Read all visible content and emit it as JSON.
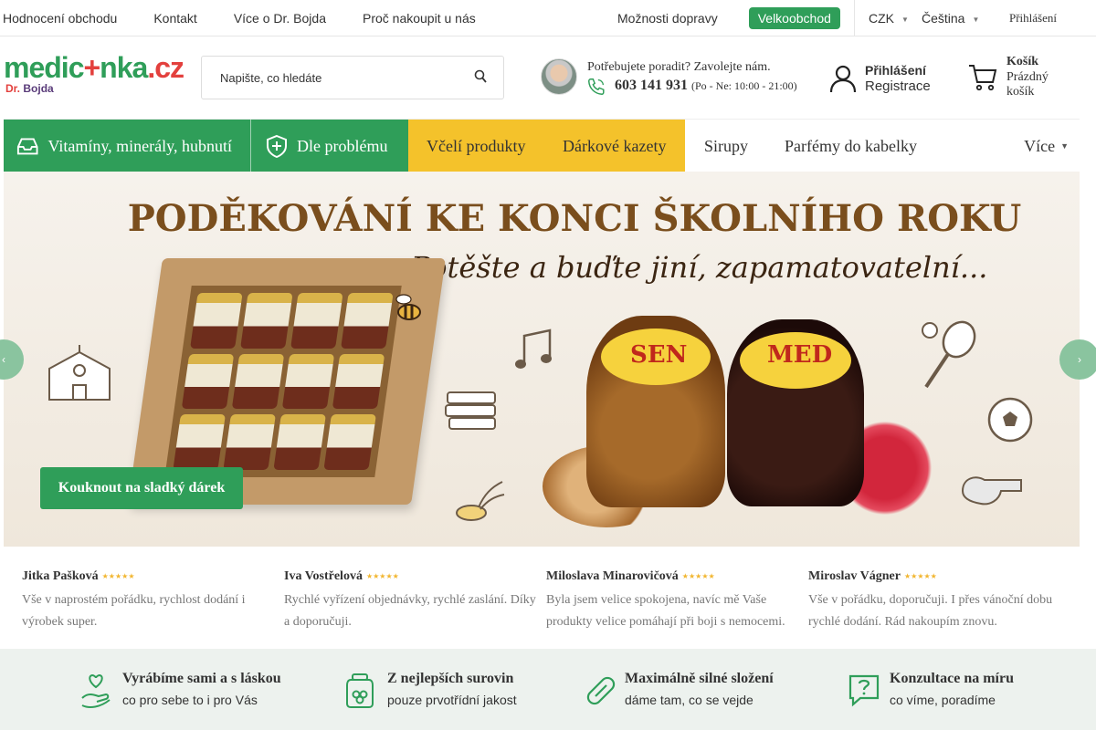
{
  "topbar": {
    "links": [
      "Hodnocení obchodu",
      "Kontakt",
      "Více o Dr. Bojda",
      "Proč nakoupit u nás"
    ],
    "shipping": "Možnosti dopravy",
    "wholesale": "Velkoobchod",
    "currency": "CZK",
    "language": "Čeština",
    "login": "Přihlášení"
  },
  "logo": {
    "part1": "medic",
    "cross": "+",
    "part2": "nka",
    "tld": ".cz",
    "sub_prefix": "Dr.",
    "sub_name": "Bojda"
  },
  "search": {
    "placeholder": "Napište, co hledáte"
  },
  "advice": {
    "question": "Potřebujete poradit? Zavolejte nám.",
    "phone": "603 141 931",
    "hours": "(Po - Ne: 10:00 - 21:00)"
  },
  "account": {
    "login": "Přihlášení",
    "register": "Registrace"
  },
  "cart": {
    "title": "Košík",
    "status": "Prázdný košík"
  },
  "nav": {
    "items": [
      "Vitamíny, minerály, hubnutí",
      "Dle problému",
      "Včelí produkty",
      "Dárkové kazety",
      "Sirupy",
      "Parfémy do kabelky"
    ],
    "more": "Více"
  },
  "banner": {
    "title": "PODĚKOVÁNÍ KE KONCI ŠKOLNÍHO ROKU",
    "subtitle": "Potěšte a buďte jiní, zapamatovatelní...",
    "jar1_label": "SEN",
    "jar2_label": "MED",
    "cta": "Kouknout na sladký dárek"
  },
  "reviews": [
    {
      "name": "Jitka Pašková",
      "stars": "★★★★★",
      "text": "Vše v naprostém pořádku, rychlost dodání i výrobek super."
    },
    {
      "name": "Iva Vostřelová",
      "stars": "★★★★★",
      "text": "Rychlé vyřízení objednávky, rychlé zaslání. Díky a doporučuji."
    },
    {
      "name": "Miloslava Minarovičová",
      "stars": "★★★★★",
      "text": "Byla jsem velice spokojena, navíc mě Vaše produkty velice pomáhají při boji s nemocemi."
    },
    {
      "name": "Miroslav Vágner",
      "stars": "★★★★★",
      "text": "Vše v pořádku, doporučuji. I přes vánoční dobu rychlé dodání. Rád nakoupím znovu."
    }
  ],
  "features": [
    {
      "title": "Vyrábíme sami a s láskou",
      "sub": "co pro sebe to i pro Vás",
      "icon": "heart-hand-icon"
    },
    {
      "title": "Z nejlepších surovin",
      "sub": "pouze prvotřídní jakost",
      "icon": "jar-icon"
    },
    {
      "title": "Maximálně silné složení",
      "sub": "dáme tam, co se vejde",
      "icon": "capsule-icon"
    },
    {
      "title": "Konzultace na míru",
      "sub": "co víme, poradíme",
      "icon": "question-chat-icon"
    }
  ],
  "colors": {
    "brand_green": "#2f9e59",
    "accent_yellow": "#f4c22b",
    "brand_red": "#e3403d"
  }
}
